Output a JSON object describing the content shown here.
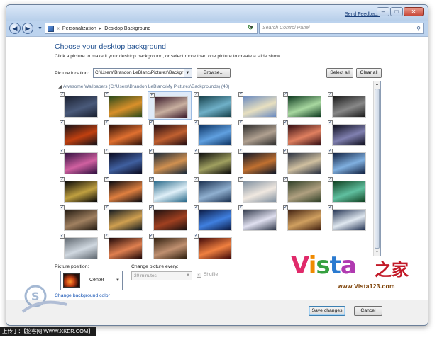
{
  "window": {
    "send_feedback": "Send Feedback",
    "caption_buttons": [
      "minimize",
      "maximize",
      "close"
    ]
  },
  "nav": {
    "breadcrumb": [
      "Personalization",
      "Desktop Background"
    ],
    "search_placeholder": "Search Control Panel"
  },
  "page": {
    "title": "Choose your desktop background",
    "intro": "Click a picture to make it your desktop background, or select more than one picture to create a slide show.",
    "location_label": "Picture location:",
    "location_value": "C:\\Users\\Brandon LeBlanc\\Pictures\\Backgr",
    "browse_label": "Browse...",
    "select_all_label": "Select all",
    "clear_all_label": "Clear all"
  },
  "gallery": {
    "group_title": "Awesome Wallpapers (C:\\Users\\Brandon LeBlanc\\My Pictures\\Backgrounds) (40)",
    "thumbnails": [
      {
        "colors": [
          "#1a2030",
          "#4a5a7a"
        ]
      },
      {
        "colors": [
          "#2a4a1a",
          "#d9902a"
        ]
      },
      {
        "colors": [
          "#3a1a2a",
          "#c9b0a0"
        ],
        "selected": true
      },
      {
        "colors": [
          "#16404a",
          "#6fb0c8"
        ]
      },
      {
        "colors": [
          "#6a8ac0",
          "#e8e0c0"
        ]
      },
      {
        "colors": [
          "#0e3a20",
          "#a8d8a0"
        ]
      },
      {
        "colors": [
          "#1a1a1a",
          "#888888"
        ]
      },
      {
        "colors": [
          "#101018",
          "#c04010"
        ]
      },
      {
        "colors": [
          "#2a0e08",
          "#e07030"
        ]
      },
      {
        "colors": [
          "#200a10",
          "#c06030"
        ]
      },
      {
        "colors": [
          "#0a3060",
          "#60a0e0"
        ]
      },
      {
        "colors": [
          "#2a2a2a",
          "#b0a090"
        ]
      },
      {
        "colors": [
          "#300a10",
          "#e08060"
        ]
      },
      {
        "colors": [
          "#0a0a18",
          "#8080b0"
        ]
      },
      {
        "colors": [
          "#301040",
          "#d060a0"
        ]
      },
      {
        "colors": [
          "#0a0a20",
          "#4060a0"
        ]
      },
      {
        "colors": [
          "#1a2a3a",
          "#d09050"
        ]
      },
      {
        "colors": [
          "#0a0a0a",
          "#a0a060"
        ]
      },
      {
        "colors": [
          "#101828",
          "#c07030"
        ]
      },
      {
        "colors": [
          "#283040",
          "#d0c0a0"
        ]
      },
      {
        "colors": [
          "#102040",
          "#80b0e0"
        ]
      },
      {
        "colors": [
          "#080808",
          "#c0a040"
        ]
      },
      {
        "colors": [
          "#0a0a10",
          "#e08040"
        ]
      },
      {
        "colors": [
          "#2a6a8a",
          "#e0f0f8"
        ]
      },
      {
        "colors": [
          "#1a3050",
          "#90b0d0"
        ]
      },
      {
        "colors": [
          "#8090a0",
          "#f0e8e0"
        ]
      },
      {
        "colors": [
          "#304028",
          "#b0a080"
        ]
      },
      {
        "colors": [
          "#104020",
          "#60c0a0"
        ]
      },
      {
        "colors": [
          "#201810",
          "#a08060"
        ]
      },
      {
        "colors": [
          "#101820",
          "#d0a050"
        ]
      },
      {
        "colors": [
          "#1a1010",
          "#a04020"
        ]
      },
      {
        "colors": [
          "#0a1840",
          "#4080e0"
        ]
      },
      {
        "colors": [
          "#30384a",
          "#e0e0f0"
        ]
      },
      {
        "colors": [
          "#402010",
          "#d0a060"
        ]
      },
      {
        "colors": [
          "#203050",
          "#e0e8f0"
        ]
      },
      {
        "colors": [
          "#606870",
          "#d0d8e0"
        ]
      },
      {
        "colors": [
          "#200808",
          "#e08050"
        ]
      },
      {
        "colors": [
          "#302010",
          "#c09070"
        ]
      },
      {
        "colors": [
          "#400808",
          "#f08040"
        ]
      }
    ]
  },
  "position": {
    "label": "Picture position:",
    "value": "Center"
  },
  "interval": {
    "label": "Change picture every:",
    "value": "20 minutes"
  },
  "shuffle": {
    "label": "Shuffle",
    "checked": true
  },
  "change_color_link": "Change background color",
  "footer": {
    "save_label": "Save changes",
    "cancel_label": "Cancel"
  },
  "watermark": {
    "logo_letters": [
      "V",
      "i",
      "s",
      "t",
      "a"
    ],
    "logo_colors": [
      "#e02a6a",
      "#f08a00",
      "#36a040",
      "#2a7ad0",
      "#b03ab0"
    ],
    "logo_suffix": "之家",
    "url": "www.Vista123.com",
    "credit": "上传于：【挖客网 WWW.XKER.COM】"
  }
}
